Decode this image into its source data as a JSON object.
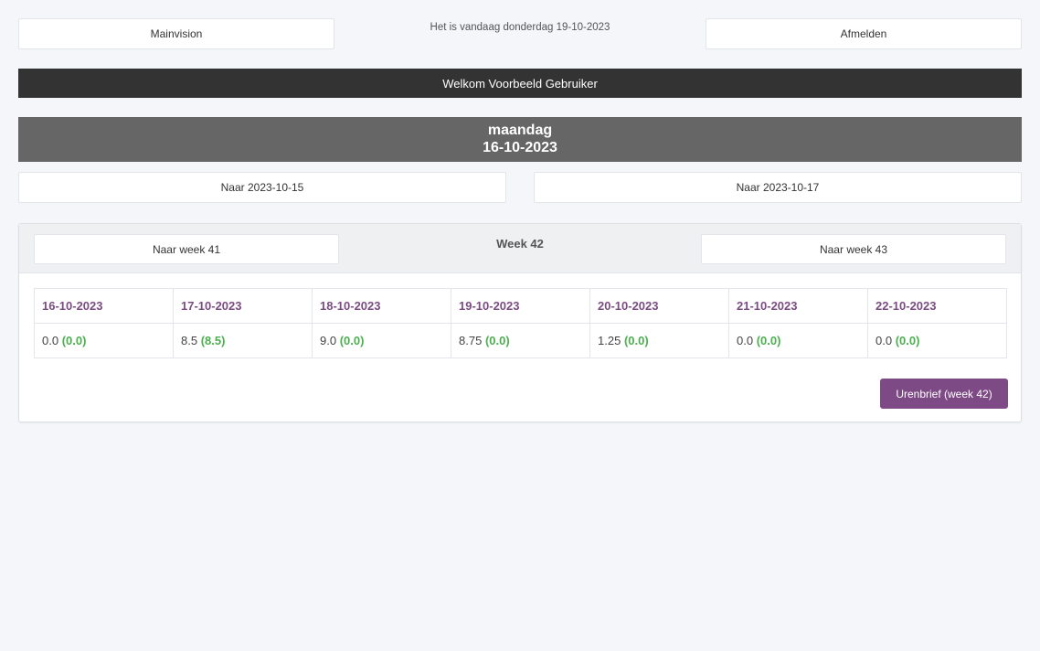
{
  "header": {
    "main_label": "Mainvision",
    "today_text": "Het is vandaag donderdag 19-10-2023",
    "logout_label": "Afmelden"
  },
  "welcome": "Welkom Voorbeeld Gebruiker",
  "day": {
    "weekday": "maandag",
    "date": "16-10-2023",
    "prev_label": "Naar 2023-10-15",
    "next_label": "Naar 2023-10-17"
  },
  "week": {
    "title": "Week 42",
    "prev_label": "Naar week 41",
    "next_label": "Naar week 43",
    "days": [
      {
        "date": "16-10-2023",
        "hours": "0.0",
        "extra": "(0.0)"
      },
      {
        "date": "17-10-2023",
        "hours": "8.5",
        "extra": "(8.5)"
      },
      {
        "date": "18-10-2023",
        "hours": "9.0",
        "extra": "(0.0)"
      },
      {
        "date": "19-10-2023",
        "hours": "8.75",
        "extra": "(0.0)"
      },
      {
        "date": "20-10-2023",
        "hours": "1.25",
        "extra": "(0.0)"
      },
      {
        "date": "21-10-2023",
        "hours": "0.0",
        "extra": "(0.0)"
      },
      {
        "date": "22-10-2023",
        "hours": "0.0",
        "extra": "(0.0)"
      }
    ],
    "report_label": "Urenbrief (week 42)"
  },
  "colors": {
    "accent": "#7e4a85",
    "green": "#4caf50",
    "dark_bar": "#333333",
    "day_bar": "#666666"
  }
}
